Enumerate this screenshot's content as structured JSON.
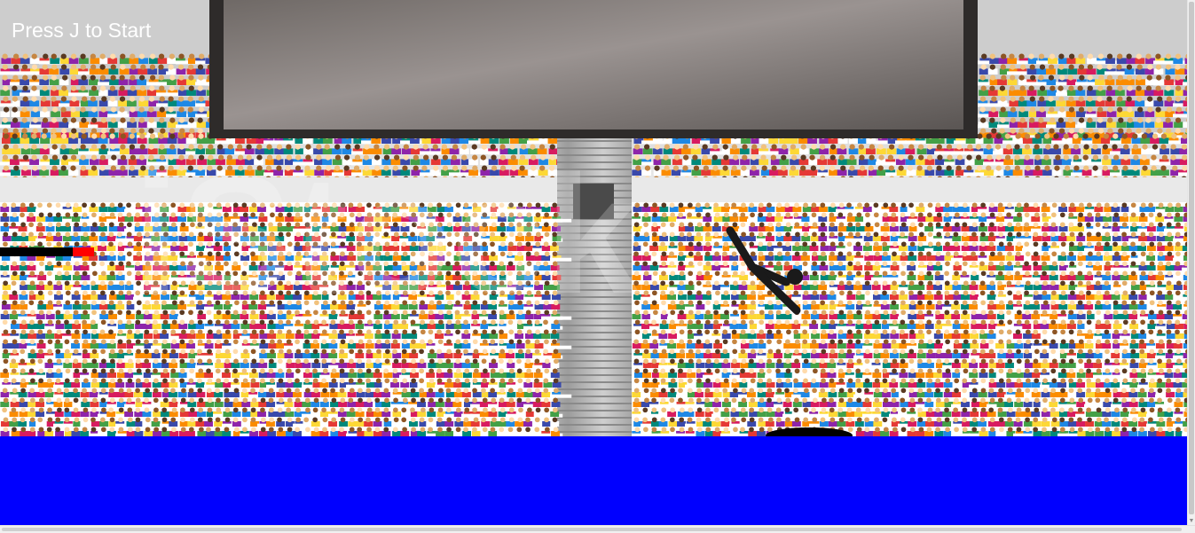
{
  "hud": {
    "start_prompt": "Press J to Start"
  },
  "power_meter": {
    "level_fraction": 0.23,
    "track_color": "#000000",
    "fill_color": "#ff0000"
  },
  "scene": {
    "pool_color": "#0000ff",
    "background": "stadium-crowd",
    "diver": "stick-figure-diver",
    "landing_target": "black-ellipse-target"
  },
  "watermark": {
    "text": "iStock"
  }
}
